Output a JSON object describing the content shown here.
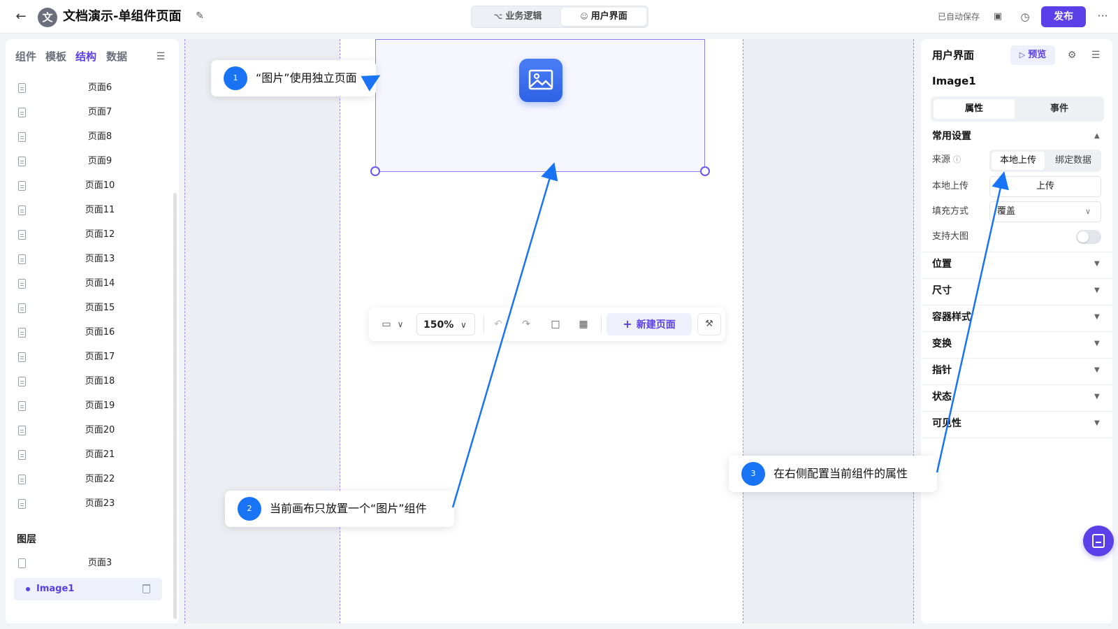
{
  "header": {
    "avatar_char": "文",
    "title": "文档演示-单组件页面",
    "mode_tabs": [
      {
        "label": "业务逻辑"
      },
      {
        "label": "用户界面"
      }
    ],
    "autosave": "已自动保存",
    "publish_label": "发布"
  },
  "left_panel": {
    "tabs": [
      "组件",
      "模板",
      "结构",
      "数据"
    ],
    "active_tab": "结构",
    "pages": [
      "页面6",
      "页面7",
      "页面8",
      "页面9",
      "页面10",
      "页面11",
      "页面12",
      "页面13",
      "页面14",
      "页面15",
      "页面16",
      "页面17",
      "页面18",
      "页面19",
      "页面20",
      "页面21",
      "页面22",
      "页面23"
    ],
    "layers_title": "图层",
    "layer_page": "页面3",
    "layer_selected": "Image1"
  },
  "toolbar": {
    "zoom": "150%",
    "new_page_label": "新建页面"
  },
  "right_panel": {
    "title": "用户界面",
    "preview_label": "预览",
    "component_name": "Image1",
    "tabs": [
      "属性",
      "事件"
    ],
    "common_section": "常用设置",
    "source_label": "来源",
    "source_options": [
      "本地上传",
      "绑定数据"
    ],
    "local_upload_label": "本地上传",
    "upload_button": "上传",
    "fill_label": "填充方式",
    "fill_value": "覆盖",
    "big_image_label": "支持大图",
    "big_image_enabled": false,
    "sections": [
      "位置",
      "尺寸",
      "容器样式",
      "变换",
      "指针",
      "状态",
      "可见性"
    ]
  },
  "callouts": [
    {
      "num": "1",
      "text": "“图片”使用独立页面"
    },
    {
      "num": "2",
      "text": "当前画布只放置一个“图片”组件"
    },
    {
      "num": "3",
      "text": "在右侧配置当前组件的属性"
    }
  ],
  "colors": {
    "accent": "#5b3fe8",
    "callout_blue": "#1874f5"
  }
}
